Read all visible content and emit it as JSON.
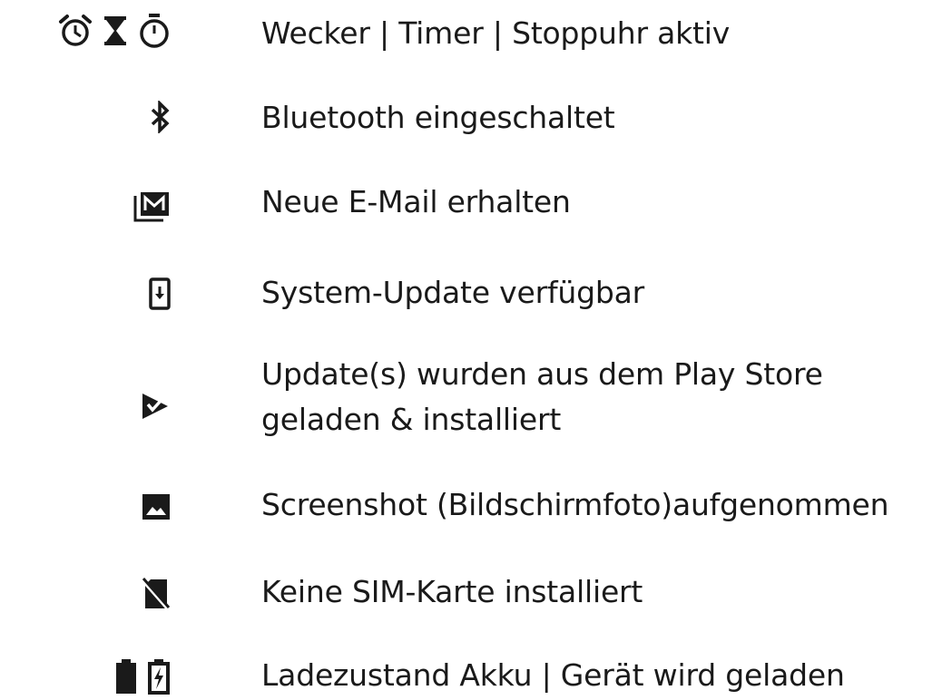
{
  "legend": {
    "items": [
      {
        "icons": [
          "alarm-clock-icon",
          "hourglass-icon",
          "stopwatch-icon"
        ],
        "label": "Wecker | Timer | Stoppuhr aktiv"
      },
      {
        "icons": [
          "bluetooth-icon"
        ],
        "label": "Bluetooth eingeschaltet"
      },
      {
        "icons": [
          "email-icon"
        ],
        "label": "Neue E-Mail erhalten"
      },
      {
        "icons": [
          "system-update-icon"
        ],
        "label": "System-Update verfügbar"
      },
      {
        "icons": [
          "play-store-update-icon"
        ],
        "label": "Update(s) wurden aus dem Play Store",
        "label_line2": "geladen & installiert"
      },
      {
        "icons": [
          "screenshot-icon"
        ],
        "label": "Screenshot (Bildschirmfoto)aufgenommen"
      },
      {
        "icons": [
          "no-sim-icon"
        ],
        "label": "Keine SIM-Karte installiert"
      },
      {
        "icons": [
          "battery-full-icon",
          "battery-charging-icon"
        ],
        "label": "Ladezustand Akku | Gerät wird geladen"
      }
    ]
  }
}
